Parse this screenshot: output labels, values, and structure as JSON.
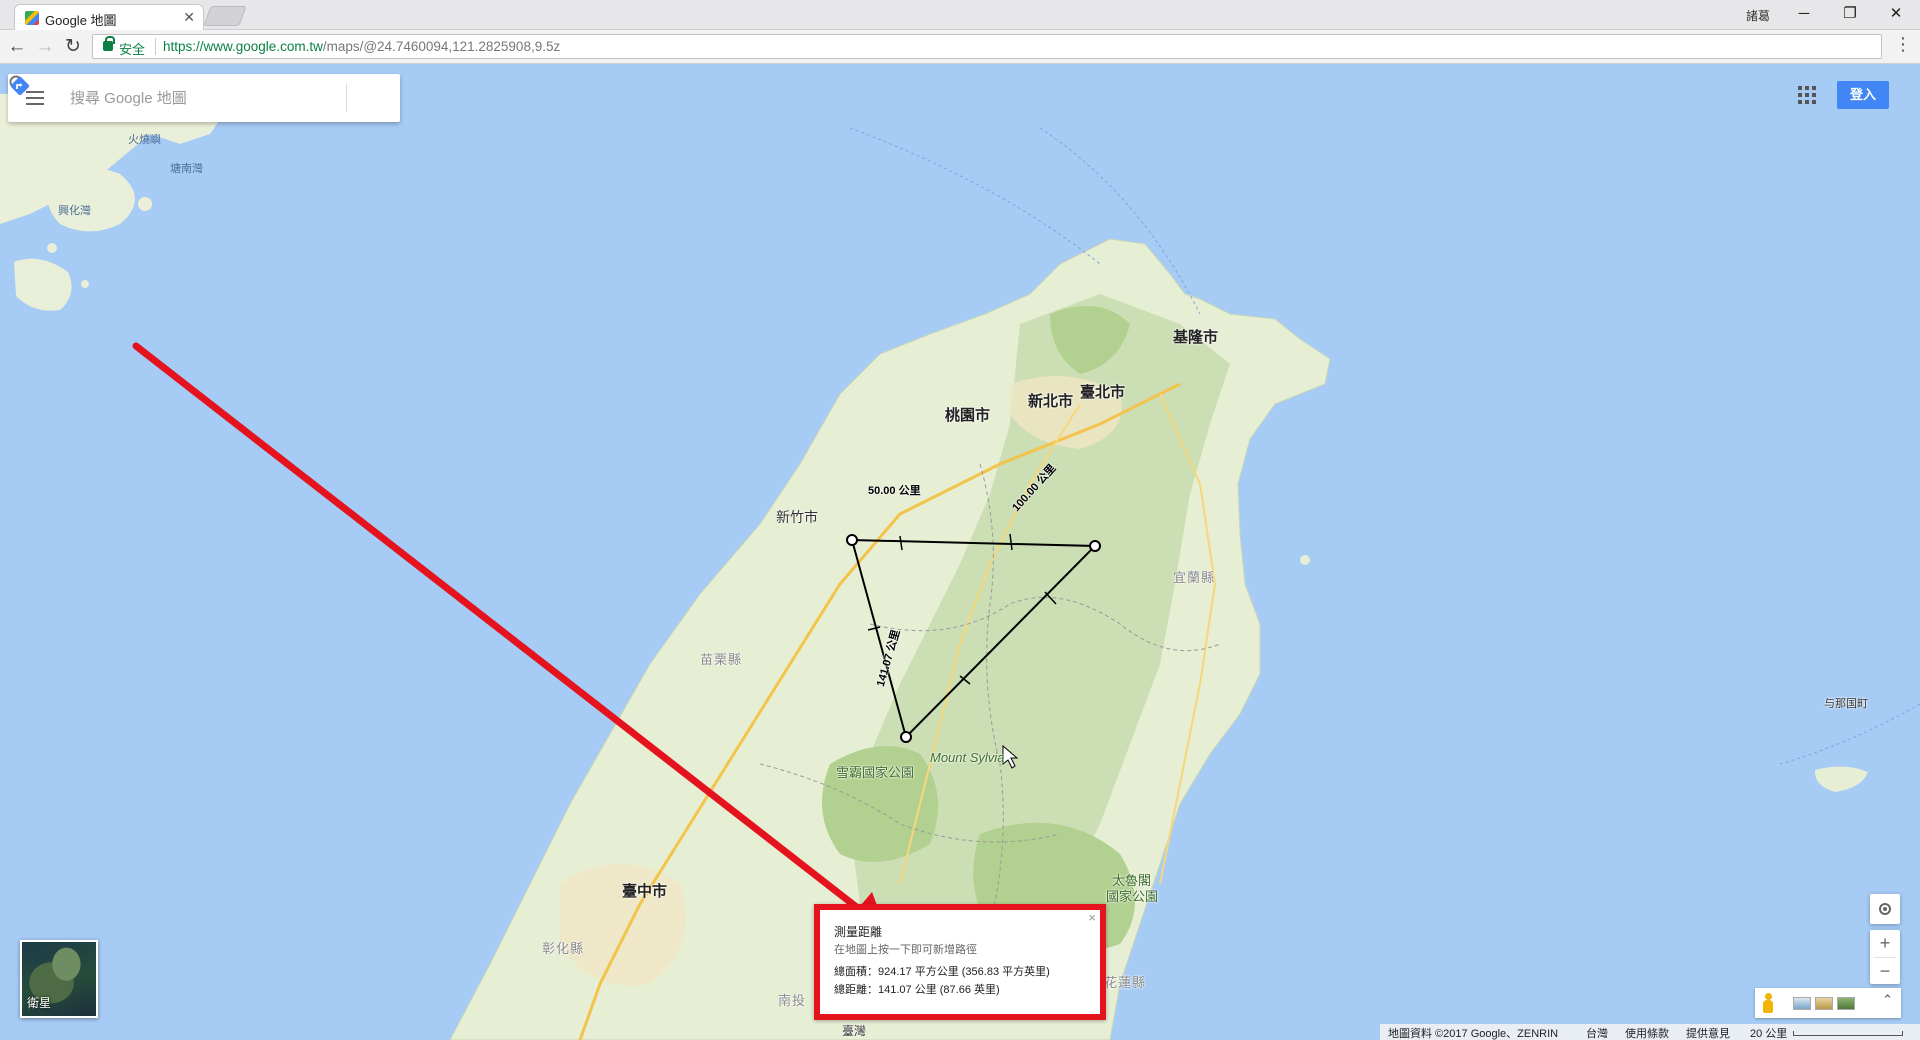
{
  "browser": {
    "tab_title": "Google 地圖",
    "tab_close": "✕",
    "user_name": "諸葛",
    "secure_label": "安全",
    "url_host": "https://www.google.com.tw",
    "url_path": "/maps/@24.7460094,121.2825908,9.5z",
    "window_buttons": [
      "─",
      "❐",
      "✕"
    ]
  },
  "search": {
    "placeholder": "搜尋 Google 地圖"
  },
  "signin_label": "登入",
  "map_labels": {
    "keelung": "基隆市",
    "taipei": "臺北市",
    "new_taipei": "新北市",
    "taoyuan": "桃園市",
    "hsinchu": "新竹市",
    "yilan": "宜蘭縣",
    "miaoli": "苗栗縣",
    "taichung": "臺中市",
    "changhua": "彰化縣",
    "nantou": "南投",
    "hualien": "花蓮縣",
    "taiwan": "臺灣",
    "shei_pa": "雪霸國家公園",
    "mount_sylvia": "Mount Sylvia",
    "taroko_1": "太魯閣",
    "taroko_2": "國家公園",
    "yonaguni": "与那国町",
    "water_1": "火燒嶼",
    "water_2": "塘南灣",
    "water_3": "興化灣"
  },
  "measure_labels": {
    "seg_50": "50.00 公里",
    "seg_100": "100.00 公里",
    "seg_141": "141.07 公里"
  },
  "measure_panel": {
    "title": "測量距離",
    "hint": "在地圖上按一下即可新增路徑",
    "area": "總面積：924.17 平方公里 (356.83 平方英里)",
    "distance": "總距離：141.07 公里 (87.66 英里)",
    "close": "×"
  },
  "satellite_label": "衛星",
  "controls": {
    "zoom_in": "+",
    "zoom_out": "−",
    "expand": "⌃"
  },
  "footer": {
    "attribution": "地圖資料 ©2017 Google、ZENRIN",
    "region": "台灣",
    "terms": "使用條款",
    "feedback": "提供意見",
    "scale": "20 公里"
  },
  "colors": {
    "water": "#a6cbf5",
    "land": "#e9efd8",
    "forest": "#b9d59d",
    "annotation_red": "#e4131d",
    "signin_blue": "#4285f4"
  }
}
